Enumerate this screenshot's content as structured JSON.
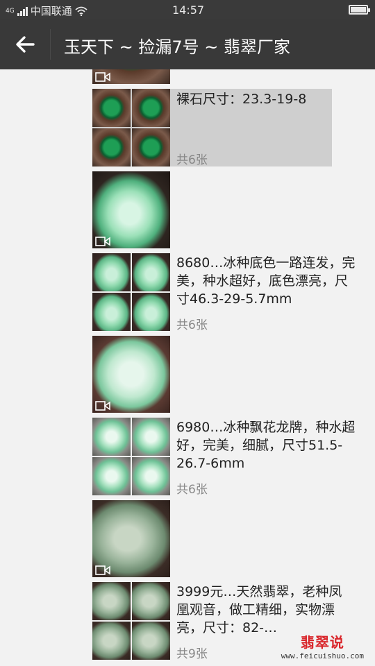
{
  "status_bar": {
    "network": "4G",
    "carrier": "中国联通",
    "time": "14:57"
  },
  "app_bar": {
    "title": "玉天下 ~ 捡漏7号 ~ 翡翠厂家"
  },
  "feed": [
    {
      "text": "",
      "count": "",
      "kind": "partial-top"
    },
    {
      "text": "裸石尺寸：23.3-19-8",
      "count": "共6张",
      "kind": "grid",
      "selected": true
    },
    {
      "text": "",
      "count": "",
      "kind": "video"
    },
    {
      "text": "8680…冰种底色一路连发，完美，种水超好，底色漂亮，尺寸46.3-29-5.7mm",
      "count": "共6张",
      "kind": "grid"
    },
    {
      "text": "",
      "count": "",
      "kind": "video"
    },
    {
      "text": "6980…冰种飘花龙牌，种水超好，完美，细腻，尺寸51.5-26.7-6mm",
      "count": "共6张",
      "kind": "grid"
    },
    {
      "text": "",
      "count": "",
      "kind": "video"
    },
    {
      "text": "3999元…天然翡翠，老种凤凰观音，做工精细，实物漂亮，尺寸：82-…",
      "count": "共9张",
      "kind": "grid"
    }
  ],
  "watermark": {
    "brand": "翡翠说",
    "site": "www.feicuishuo.com"
  },
  "colors": {
    "status_bar_bg": "#3a3a3a",
    "app_bar_bg": "#393939",
    "selected_bg": "#cfcfcf",
    "watermark_red": "#d9262b"
  }
}
